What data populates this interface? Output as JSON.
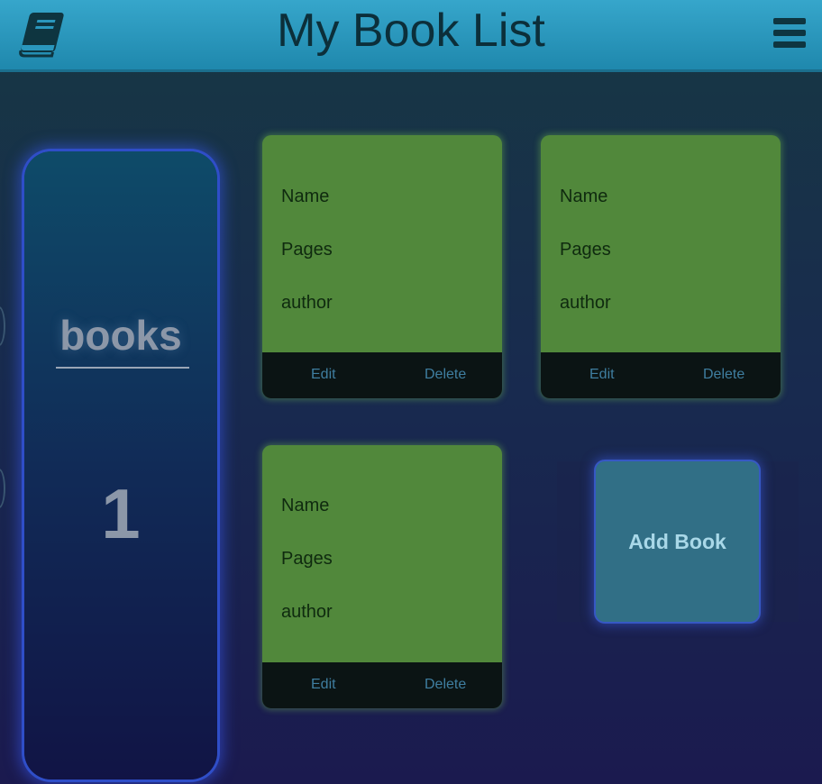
{
  "header": {
    "title": "My Book List",
    "logo_icon": "book-icon",
    "menu_icon": "hamburger-menu-icon"
  },
  "counter": {
    "label": "books",
    "value": "1"
  },
  "books": [
    {
      "name": "Name",
      "pages": "Pages",
      "author": "author",
      "edit": "Edit",
      "delete": "Delete"
    },
    {
      "name": "Name",
      "pages": "Pages",
      "author": "author",
      "edit": "Edit",
      "delete": "Delete"
    },
    {
      "name": "Name",
      "pages": "Pages",
      "author": "author",
      "edit": "Edit",
      "delete": "Delete"
    }
  ],
  "add_book": {
    "label": "Add Book"
  },
  "colors": {
    "header": "#2a97bd",
    "card": "#51883b",
    "card_footer": "#0b1414",
    "add_button": "#316f86",
    "glow": "#2f4ec8"
  }
}
